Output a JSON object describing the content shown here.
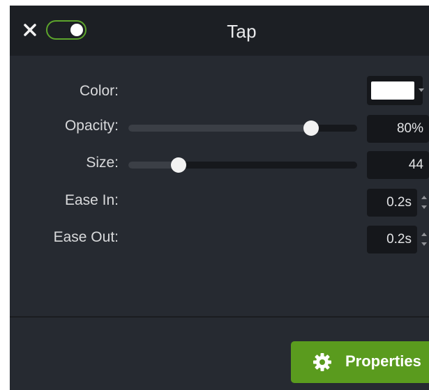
{
  "header": {
    "title": "Tap",
    "enabled": true
  },
  "properties": {
    "color": {
      "label": "Color:",
      "value": "#ffffff"
    },
    "opacity": {
      "label": "Opacity:",
      "value": "80%",
      "level": 0.8
    },
    "size": {
      "label": "Size:",
      "value": "44",
      "level": 0.22
    },
    "ease_in": {
      "label": "Ease In:",
      "value": "0.2s"
    },
    "ease_out": {
      "label": "Ease Out:",
      "value": "0.2s"
    }
  },
  "footer": {
    "properties_button_label": "Properties"
  },
  "colors": {
    "accent": "#5a9b1e",
    "panel_bg": "#262a31",
    "titlebar_bg": "#1c1f24"
  },
  "icons": {
    "close": "close-icon",
    "gear": "gear-icon"
  }
}
